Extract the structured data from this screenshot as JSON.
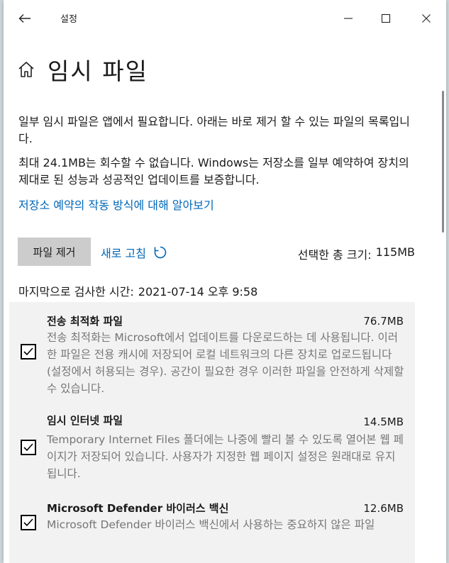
{
  "titlebar": {
    "app_title": "설정",
    "back_icon": "back-arrow-icon",
    "minimize_icon": "minimize-icon",
    "maximize_icon": "maximize-icon",
    "close_icon": "close-icon"
  },
  "page": {
    "title": "임시 파일",
    "icon": "home-icon",
    "description1": "일부 임시 파일은 앱에서 필요합니다. 아래는 바로 제거 할 수 있는 파일의 목록입니다.",
    "description2": "최대 24.1MB는 회수할 수 없습니다. Windows는 저장소를 일부 예약하여 장치의 제대로 된 성능과 성공적인 업데이트를 보증합니다.",
    "learn_more_link": "저장소 예약의 작동 방식에 대해 알아보기"
  },
  "actions": {
    "remove_button": "파일 제거",
    "refresh_link": "새로 고침",
    "refresh_icon": "refresh-icon",
    "total_label": "선택한 총 크기:",
    "total_value": "115MB"
  },
  "scan": {
    "label": "마지막으로 검사한 시간:",
    "value": "2021-07-14 오후 9:58"
  },
  "items": [
    {
      "title": "전송 최적화 파일",
      "size": "76.7MB",
      "checked": true,
      "desc": "전송 최적화는 Microsoft에서 업데이트를 다운로드하는 데 사용됩니다. 이러한 파일은 전용 캐시에 저장되어 로컬 네트워크의 다른 장치로 업로드됩니다(설정에서 허용되는 경우). 공간이 필요한 경우 이러한 파일을 안전하게 삭제할 수 있습니다."
    },
    {
      "title": "임시 인터넷 파일",
      "size": "14.5MB",
      "checked": true,
      "desc": "Temporary Internet Files 폴더에는 나중에 빨리 볼 수 있도록 열어본 웹 페이지가 저장되어 있습니다. 사용자가 지정한 웹 페이지 설정은 원래대로 유지됩니다."
    },
    {
      "title": "Microsoft Defender 바이러스 백신",
      "size": "12.6MB",
      "checked": true,
      "desc": "Microsoft Defender 바이러스 백신에서 사용하는 중요하지 않은 파일"
    }
  ]
}
